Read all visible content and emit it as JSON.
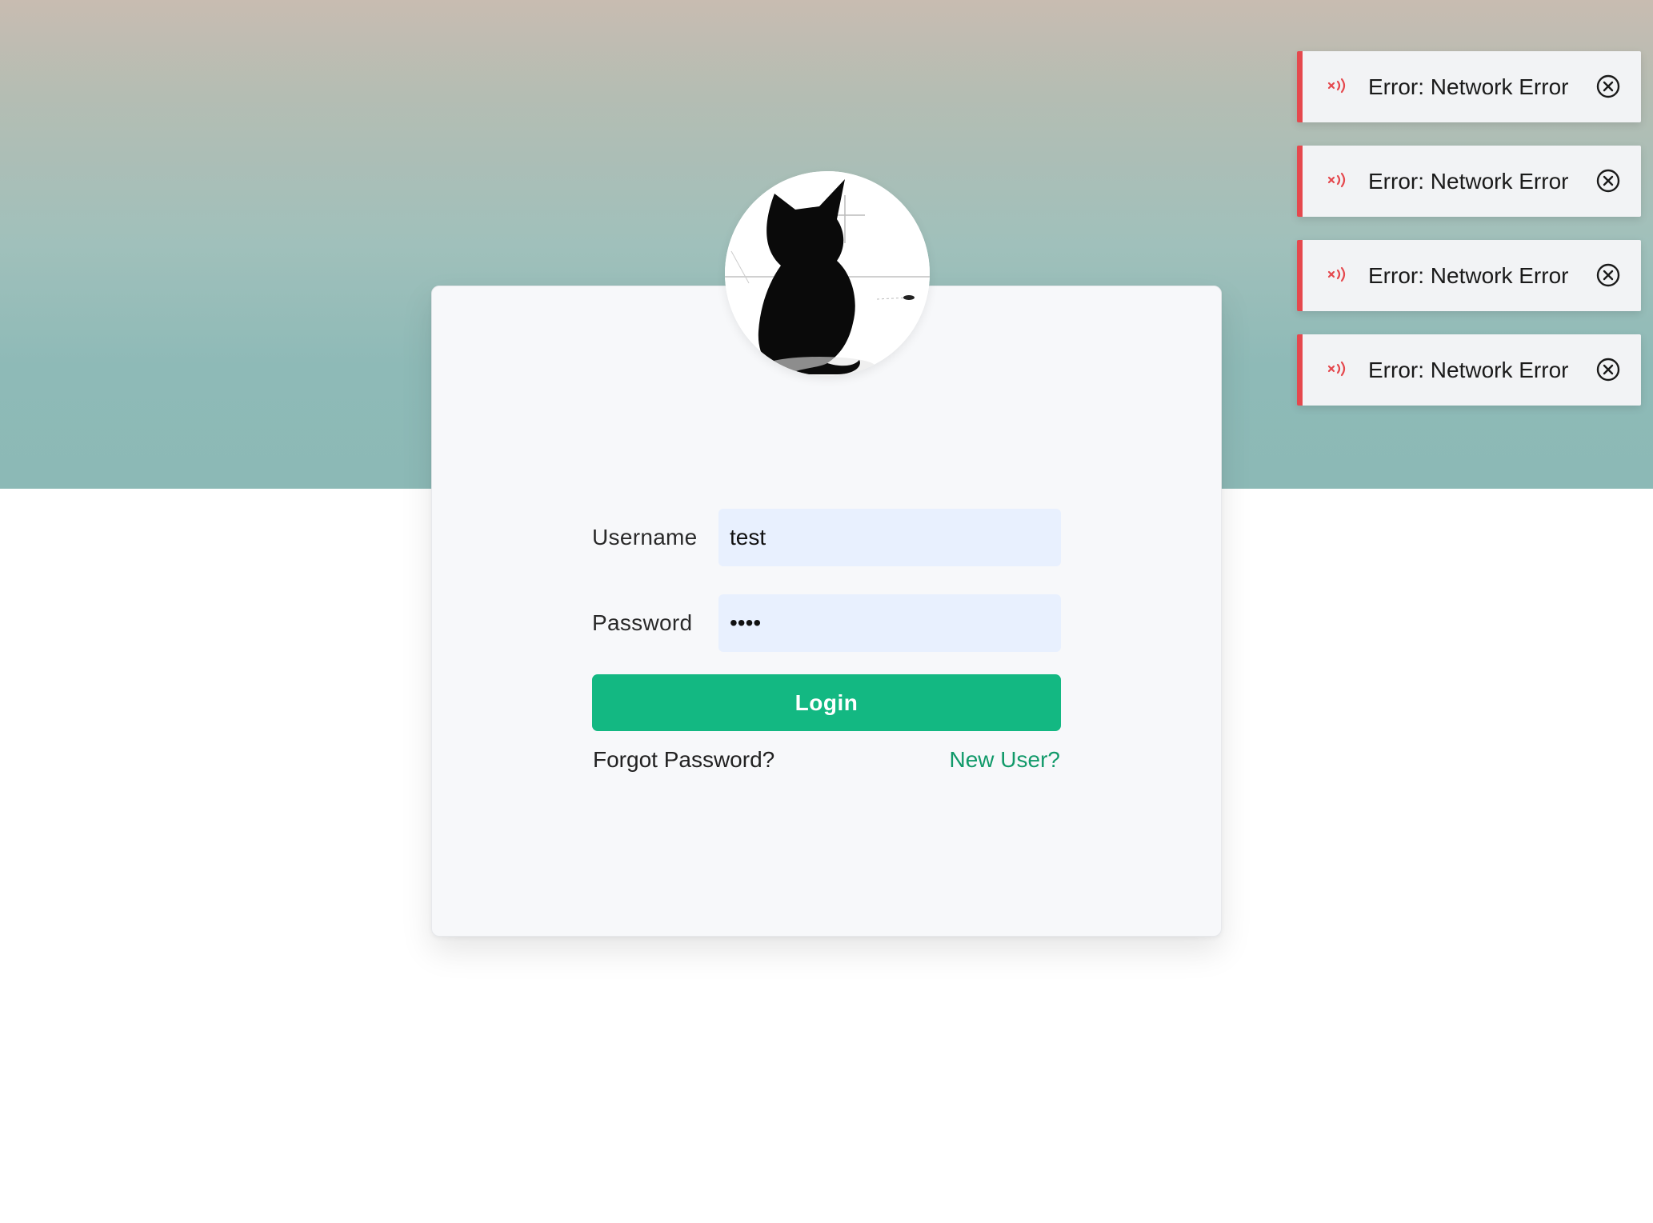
{
  "theme": {
    "accent": "#13b882",
    "link_accent": "#129a6a",
    "error": "#e5484d",
    "input_bg": "#e8f0fe"
  },
  "avatar": {
    "icon": "black-cat-silhouette"
  },
  "login_form": {
    "username_label": "Username",
    "username_value": "test",
    "password_label": "Password",
    "password_value": "test",
    "login_button": "Login",
    "forgot_password": "Forgot Password?",
    "new_user": "New User?"
  },
  "toasts": [
    {
      "message": "Error: Network Error",
      "icon": "network-error-icon",
      "close_icon": "close-circle-icon"
    },
    {
      "message": "Error: Network Error",
      "icon": "network-error-icon",
      "close_icon": "close-circle-icon"
    },
    {
      "message": "Error: Network Error",
      "icon": "network-error-icon",
      "close_icon": "close-circle-icon"
    },
    {
      "message": "Error: Network Error",
      "icon": "network-error-icon",
      "close_icon": "close-circle-icon"
    }
  ]
}
